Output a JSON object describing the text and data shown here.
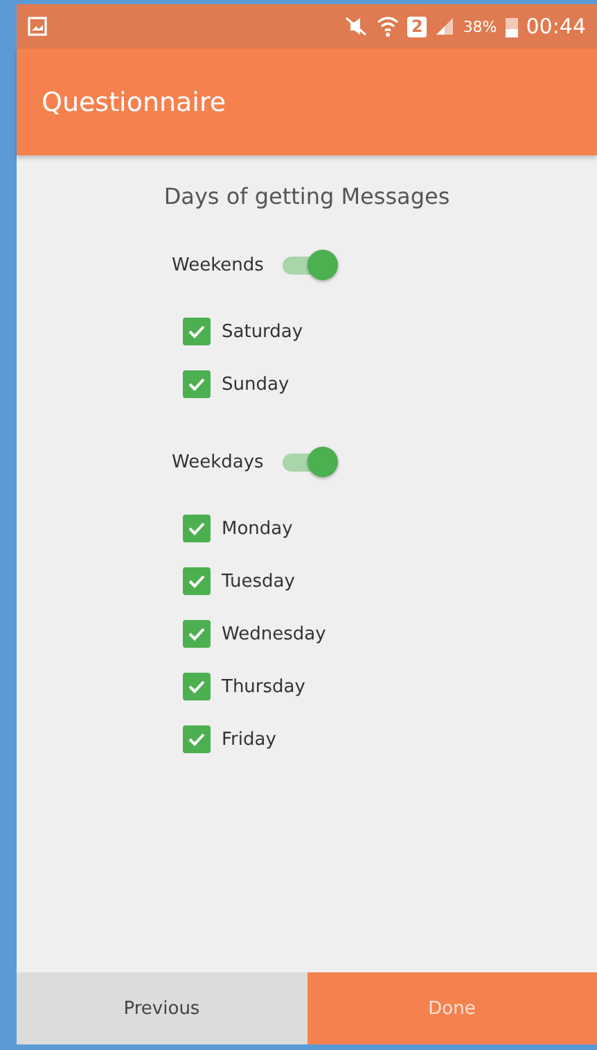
{
  "status_bar": {
    "sim_slot": "2",
    "battery_percent": "38%",
    "time": "00:44"
  },
  "app_bar": {
    "title": "Questionnaire"
  },
  "heading": "Days of getting Messages",
  "groups": [
    {
      "label": "Weekends",
      "on": true,
      "items": [
        {
          "label": "Saturday",
          "checked": true
        },
        {
          "label": "Sunday",
          "checked": true
        }
      ]
    },
    {
      "label": "Weekdays",
      "on": true,
      "items": [
        {
          "label": "Monday",
          "checked": true
        },
        {
          "label": "Tuesday",
          "checked": true
        },
        {
          "label": "Wednesday",
          "checked": true
        },
        {
          "label": "Thursday",
          "checked": true
        },
        {
          "label": "Friday",
          "checked": true
        }
      ]
    }
  ],
  "buttons": [
    {
      "label": "Previous",
      "kind": "secondary"
    },
    {
      "label": "Done",
      "kind": "primary"
    }
  ]
}
